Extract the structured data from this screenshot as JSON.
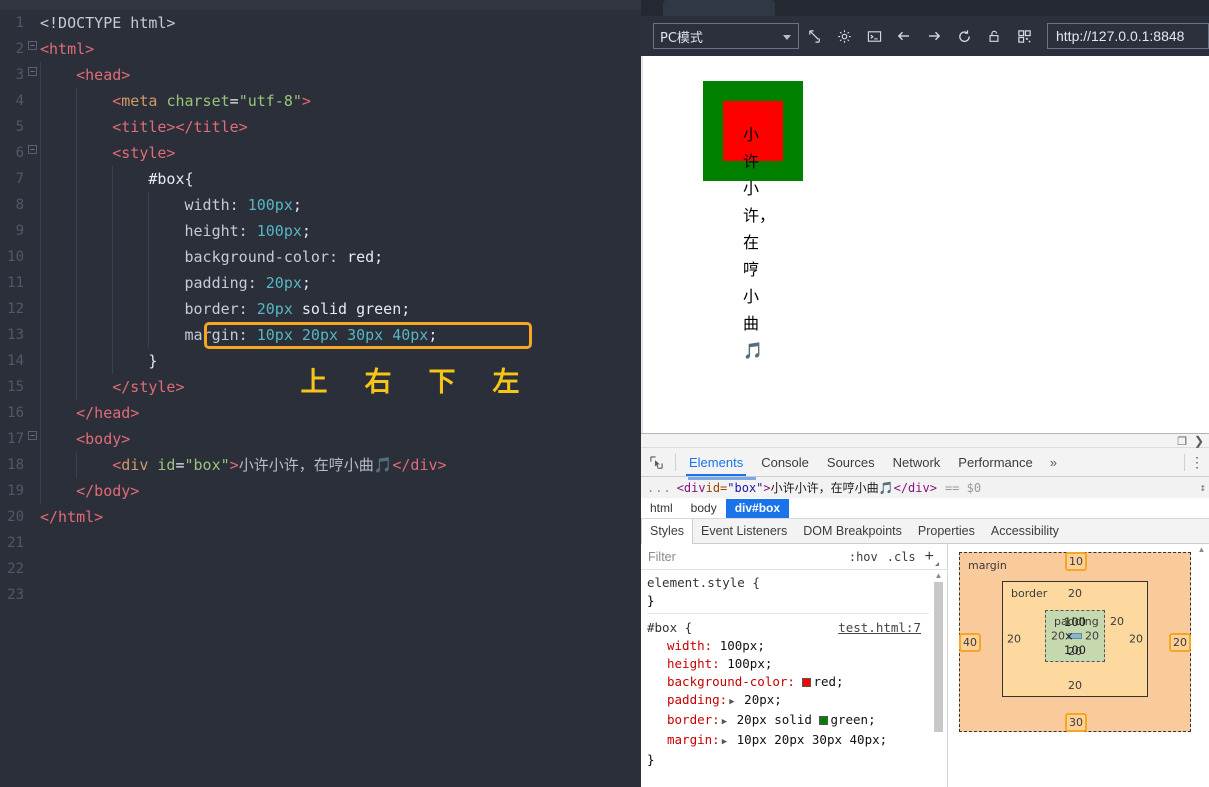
{
  "editor": {
    "lines": [
      {
        "n": "1",
        "fold": false,
        "html": "<span class=\"doct\">&lt;!DOCTYPE html&gt;</span>"
      },
      {
        "n": "2",
        "fold": true,
        "html": "<span class=\"tg\">&lt;html&gt;</span>"
      },
      {
        "n": "3",
        "fold": true,
        "html": "    <span class=\"tg\">&lt;head&gt;</span>"
      },
      {
        "n": "4",
        "fold": false,
        "html": "        <span class=\"tg\">&lt;</span><span class=\"at\">meta</span> <span class=\"st\">charset</span><span class=\"pl\">=</span><span class=\"st\">\"utf-8\"</span><span class=\"tg\">&gt;</span>"
      },
      {
        "n": "5",
        "fold": false,
        "html": "        <span class=\"tg\">&lt;title&gt;&lt;/title&gt;</span>"
      },
      {
        "n": "6",
        "fold": true,
        "html": "        <span class=\"tg\">&lt;style&gt;</span>"
      },
      {
        "n": "7",
        "fold": false,
        "html": "            <span class=\"sel\">#box{</span>"
      },
      {
        "n": "8",
        "fold": false,
        "html": "                <span class=\"prop\">width:</span> <span class=\"num\">100px</span><span class=\"pl\">;</span>"
      },
      {
        "n": "9",
        "fold": false,
        "html": "                <span class=\"prop\">height:</span> <span class=\"num\">100px</span><span class=\"pl\">;</span>"
      },
      {
        "n": "10",
        "fold": false,
        "html": "                <span class=\"prop\">background-color:</span> <span class=\"pl\">red;</span>"
      },
      {
        "n": "11",
        "fold": false,
        "html": "                <span class=\"prop\">padding:</span> <span class=\"num\">20px</span><span class=\"pl\">;</span>"
      },
      {
        "n": "12",
        "fold": false,
        "html": "                <span class=\"prop\">border:</span> <span class=\"num\">20px</span> <span class=\"pl\">solid green;</span>"
      },
      {
        "n": "13",
        "fold": false,
        "html": "                <span class=\"prop\">margin:</span> <span class=\"num\">10px</span> <span class=\"num\">20px</span> <span class=\"num\">30px</span> <span class=\"num\">40px</span><span class=\"pl\">;</span>"
      },
      {
        "n": "14",
        "fold": false,
        "html": "            <span class=\"sel\">}</span>"
      },
      {
        "n": "15",
        "fold": false,
        "html": "        <span class=\"tg\">&lt;/style&gt;</span>"
      },
      {
        "n": "16",
        "fold": false,
        "html": "    <span class=\"tg\">&lt;/head&gt;</span>"
      },
      {
        "n": "17",
        "fold": true,
        "html": "    <span class=\"tg\">&lt;body&gt;</span>"
      },
      {
        "n": "18",
        "fold": false,
        "html": "        <span class=\"tg\">&lt;</span><span class=\"at\">div</span> <span class=\"st\">id</span><span class=\"pl\">=</span><span class=\"st\">\"box\"</span><span class=\"tg\">&gt;</span><span class=\"cjk\">小许小许，在哼小曲🎵</span><span class=\"tg\">&lt;/div&gt;</span>"
      },
      {
        "n": "19",
        "fold": false,
        "html": "    <span class=\"tg\">&lt;/body&gt;</span>"
      },
      {
        "n": "20",
        "fold": false,
        "html": "<span class=\"tg\">&lt;/html&gt;</span>"
      },
      {
        "n": "21",
        "fold": false,
        "html": ""
      },
      {
        "n": "22",
        "fold": false,
        "html": ""
      },
      {
        "n": "23",
        "fold": false,
        "html": ""
      }
    ],
    "annotation": [
      "上",
      "右",
      "下",
      "左"
    ],
    "highlight_color": "#f5a623",
    "annotation_color": "#f5c518"
  },
  "browser": {
    "tab_label": "",
    "mode_select": "PC模式",
    "toolbar_icons": [
      "popout-icon",
      "gear-icon",
      "console-icon",
      "back-arrow-icon",
      "forward-arrow-icon",
      "reload-icon",
      "lock-icon",
      "qrcode-icon"
    ],
    "url": "http://127.0.0.1:8848"
  },
  "preview": {
    "box_text_line1": "小许小许，在",
    "box_text_line2": "哼小曲",
    "box_note_glyph": "🎵",
    "background_color": "#ff0000",
    "border_color": "#008000"
  },
  "devtools": {
    "tabs": [
      {
        "label": "Elements",
        "active": true
      },
      {
        "label": "Console",
        "active": false
      },
      {
        "label": "Sources",
        "active": false
      },
      {
        "label": "Network",
        "active": false
      },
      {
        "label": "Performance",
        "active": false
      }
    ],
    "more_tabs_glyph": "»",
    "dom_row": {
      "dots": "...",
      "open_tag": "<div ",
      "attr_name": "id=",
      "attr_value": "\"box\"",
      "gt": ">",
      "text": "小许小许，在哼小曲🎵",
      "close_tag": "</div>",
      "selected_marker": "== $0"
    },
    "breadcrumbs": [
      {
        "label": "html",
        "selected": false
      },
      {
        "label": "body",
        "selected": false
      },
      {
        "label": "div#box",
        "selected": true
      }
    ],
    "style_tabs": [
      {
        "label": "Styles",
        "active": true
      },
      {
        "label": "Event Listeners",
        "active": false
      },
      {
        "label": "DOM Breakpoints",
        "active": false
      },
      {
        "label": "Properties",
        "active": false
      },
      {
        "label": "Accessibility",
        "active": false
      }
    ],
    "filter": {
      "placeholder": "Filter",
      "hov": ":hov",
      "cls": ".cls",
      "plus": "+"
    },
    "css_rules": [
      {
        "selector": "element.style {",
        "source": "",
        "declarations": [],
        "close": "}"
      },
      {
        "selector": "#box {",
        "source": "test.html:7",
        "declarations": [
          {
            "name": "width:",
            "value": "100px;",
            "expandable": false,
            "swatch": ""
          },
          {
            "name": "height:",
            "value": "100px;",
            "expandable": false,
            "swatch": ""
          },
          {
            "name": "background-color:",
            "value": "red;",
            "expandable": false,
            "swatch": "#ff0000"
          },
          {
            "name": "padding:",
            "value": "20px;",
            "expandable": true,
            "swatch": ""
          },
          {
            "name": "border:",
            "value": "20px solid green;",
            "expandable": true,
            "swatch": "#008000",
            "swatch_before": "green;"
          },
          {
            "name": "margin:",
            "value": "10px 20px 30px 40px;",
            "expandable": true,
            "swatch": ""
          }
        ],
        "close": "}"
      }
    ],
    "box_model": {
      "margin_label": "margin",
      "border_label": "border",
      "padding_label": "padding",
      "content_size": "100 × 100",
      "margin_top": "10",
      "margin_right": "20",
      "margin_bottom": "30",
      "margin_left": "40",
      "border_top": "20",
      "border_right": "20",
      "border_bottom": "20",
      "border_left": "20",
      "padding_top": "20",
      "padding_right": "20",
      "padding_bottom": "20",
      "padding_left": "20",
      "highlight_color": "#f5a623"
    }
  }
}
